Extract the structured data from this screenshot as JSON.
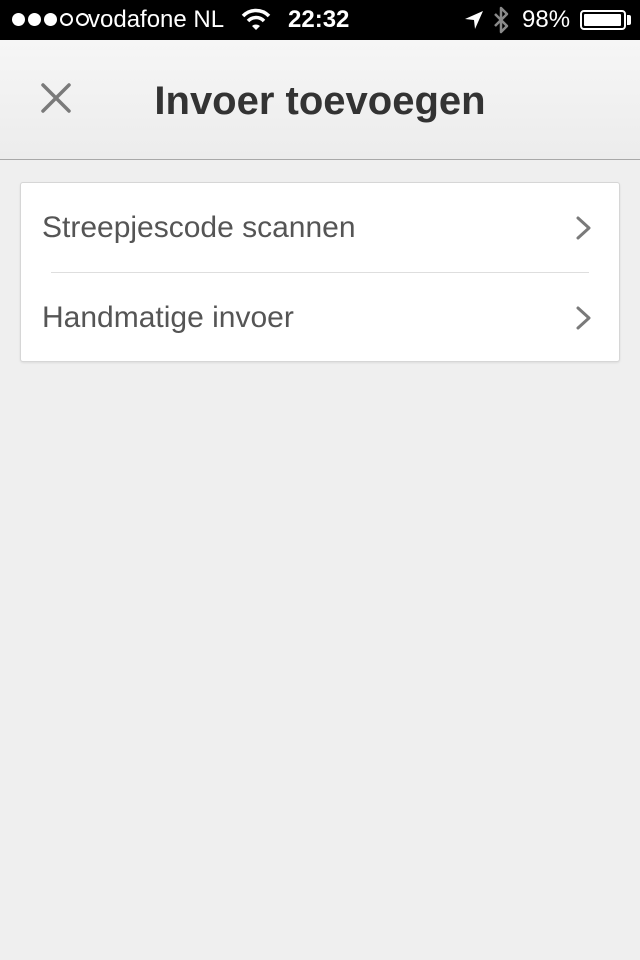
{
  "status_bar": {
    "signal_icon": "signal-dots-icon",
    "carrier": "vodafone NL",
    "wifi_icon": "wifi-icon",
    "time": "22:32",
    "location_icon": "location-arrow-icon",
    "bluetooth_icon": "bluetooth-icon",
    "battery_percent": "98%",
    "battery_level": 0.98
  },
  "nav": {
    "close_icon": "close-icon",
    "title": "Invoer toevoegen"
  },
  "menu": {
    "items": [
      {
        "label": "Streepjescode scannen",
        "icon": "chevron-right-icon"
      },
      {
        "label": "Handmatige invoer",
        "icon": "chevron-right-icon"
      }
    ]
  },
  "colors": {
    "background": "#efefef",
    "text": "#555555",
    "title": "#333333",
    "icon": "#7a7a7a"
  }
}
